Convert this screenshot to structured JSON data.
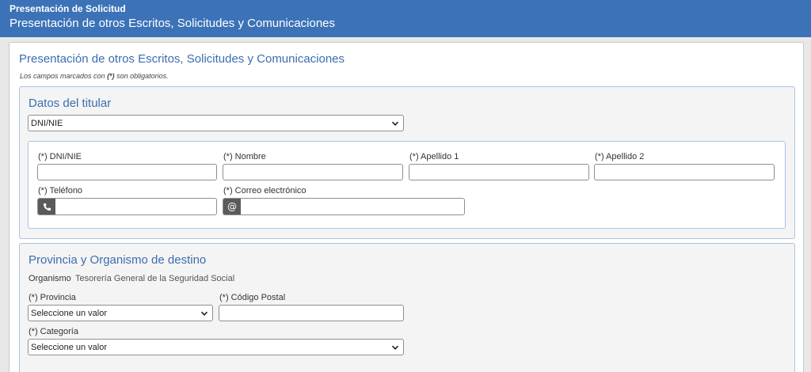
{
  "header": {
    "title": "Presentación de Solicitud",
    "subtitle": "Presentación de otros Escritos, Solicitudes y Comunicaciones"
  },
  "form": {
    "title": "Presentación de otros Escritos, Solicitudes y Comunicaciones",
    "required_note_prefix": "Los campos marcados con ",
    "required_note_marker": "(*)",
    "required_note_suffix": " son obligatorios."
  },
  "titular": {
    "title": "Datos del titular",
    "doc_type_selected": "DNI/NIE",
    "fields": {
      "dni_label": "(*) DNI/NIE",
      "nombre_label": "(*) Nombre",
      "apellido1_label": "(*) Apellido 1",
      "apellido2_label": "(*) Apellido 2",
      "telefono_label": "(*) Teléfono",
      "correo_label": "(*) Correo electrónico",
      "telefono_icon": "phone-icon",
      "correo_icon": "at-icon",
      "correo_addon": "@"
    }
  },
  "destino": {
    "title": "Provincia y Organismo de destino",
    "organismo_label": "Organismo",
    "organismo_value": "Tesorería General de la Seguridad Social",
    "provincia_label": "(*) Provincia",
    "provincia_selected": "Seleccione un valor",
    "cp_label": "(*) Código Postal",
    "categoria_label": "(*) Categoría",
    "categoria_selected": "Seleccione un valor"
  },
  "colors": {
    "header_bg": "#3c73b8",
    "title_blue": "#3c6db1",
    "section_border": "#a9c4e3",
    "addon_bg": "#5a5a5a"
  }
}
